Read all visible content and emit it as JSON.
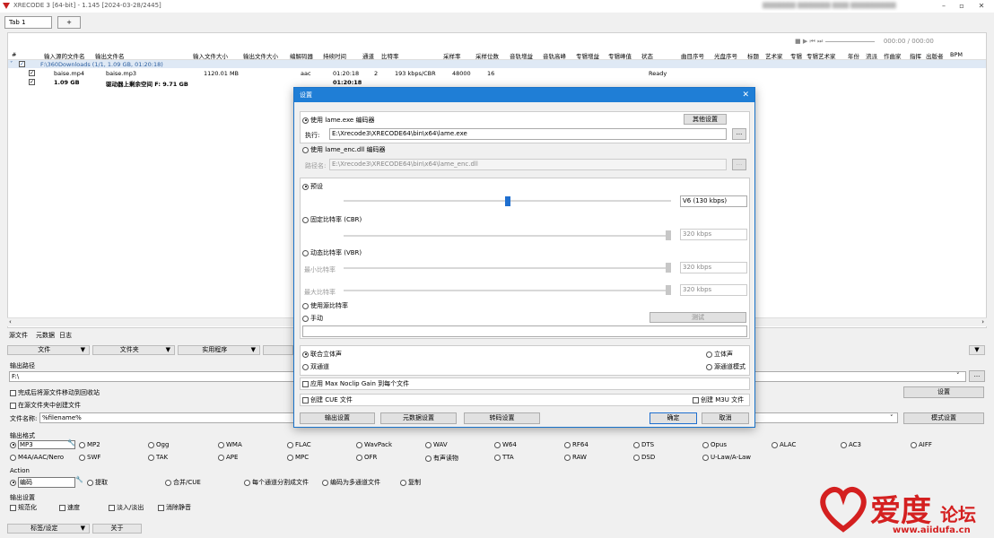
{
  "app": {
    "title": "XRECODE 3 [64-bit] - 1.145 [2024-03-28/2445]",
    "user_blurred": "████████ ████████ ████ ███████████"
  },
  "tabs": [
    {
      "label": "Tab 1"
    },
    {
      "label": "+"
    }
  ],
  "player": {
    "time": "000:00 / 000:00"
  },
  "columns": [
    "#",
    "输入源的文件名",
    "输出文件名",
    "输入文件大小",
    "输出文件大小",
    "编解码器",
    "持续时间",
    "通道",
    "比特率",
    "采样率",
    "采样位数",
    "音轨增益",
    "音轨高峰",
    "专辑增益",
    "专辑峰值",
    "状态",
    "曲目序号",
    "光盘序号",
    "标题",
    "艺术家",
    "专辑",
    "专辑艺术家",
    "年份",
    "流派",
    "作曲家",
    "指挥",
    "出版者",
    "BPM"
  ],
  "group": {
    "label": "F:\\360Downloads (1/1, 1.09 GB, 01:20:18)"
  },
  "rows": [
    {
      "input": "baise.mp4",
      "output": "baise.mp3",
      "in_size": "1120.01 MB",
      "codec": "aac",
      "duration": "01:20:18",
      "channels": "2",
      "bitrate": "193 kbps/CBR",
      "samplerate": "48000",
      "bits": "16",
      "status": "Ready"
    },
    {
      "input": "1.09 GB",
      "output": "驱动器上剩余空间 F: 9.71 GB",
      "duration": "01:20:18"
    }
  ],
  "subtabs": [
    "源文件",
    "元数据",
    "日志"
  ],
  "toolbar": [
    "文件",
    "文件夹",
    "实用程序"
  ],
  "output_path": {
    "label": "输出路径",
    "value": "F:\\",
    "browse": "...",
    "settings_btn": "设置"
  },
  "options": {
    "move_source": "完成后将源文件移动到回收站",
    "create_in_source": "在源文件夹中创建文件"
  },
  "filename": {
    "label": "文件名称:",
    "value": "%filename%",
    "mode_btn": "模式设置"
  },
  "output_format": {
    "label": "输出格式",
    "row1": [
      "MP3",
      "MP2",
      "Ogg",
      "WMA",
      "FLAC",
      "WavPack",
      "WAV",
      "W64",
      "RF64",
      "DTS",
      "Opus",
      "ALAC",
      "AC3",
      "AIFF"
    ],
    "row2": [
      "M4A/AAC/Nero",
      "SWF",
      "TAK",
      "APE",
      "MPC",
      "OFR",
      "有声读物",
      "TTA",
      "RAW",
      "DSD",
      "U-Law/A-Law"
    ]
  },
  "action": {
    "label": "Action",
    "items": [
      "编码",
      "提取",
      "合并/CUE",
      "每个通道分割成文件",
      "编码为多通道文件",
      "复制"
    ]
  },
  "output_settings": {
    "label": "输出设置",
    "items": [
      "规范化",
      "速度",
      "淡入/淡出",
      "消除静音"
    ]
  },
  "bottom": {
    "tags_btn": "标签/设定",
    "about_btn": "关于"
  },
  "dialog": {
    "title": "设置",
    "lame_exe": "使用 lame.exe 编码器",
    "other_settings": "其他设置",
    "exec_label": "执行:",
    "exec_path": "E:\\Xrecode3\\XRECODE64\\bin\\x64\\lame.exe",
    "lame_dll": "使用 lame_enc.dll 编码器",
    "path_label": "路径名:",
    "dll_path": "E:\\Xrecode3\\XRECODE64\\bin\\x64\\lame_enc.dll",
    "preset": "预设",
    "preset_value": "V6 (130 kbps)",
    "preset_level": 0.5,
    "cbr": "固定比特率 (CBR)",
    "cbr_value": "320 kbps",
    "vbr": "动态比特率 (VBR)",
    "min_label": "最小比特率",
    "min_value": "320 kbps",
    "max_label": "最大比特率",
    "max_value": "320 kbps",
    "use_source": "使用源比特率",
    "manual": "手动",
    "test_btn": "测试",
    "joint_stereo": "联合立体声",
    "stereo": "立体声",
    "dual_channel": "双通道",
    "source_channel": "源通道模式",
    "max_noclip": "应用 Max Noclip Gain 到每个文件",
    "create_cue": "创建 CUE 文件",
    "create_m3u": "创建 M3U 文件",
    "btn_output": "输出设置",
    "btn_meta": "元数据设置",
    "btn_transcode": "转码设置",
    "btn_ok": "确定",
    "btn_cancel": "取消"
  },
  "watermark": {
    "text": "爱度",
    "text2": "论坛",
    "url": "www.aiidufa.cn"
  }
}
